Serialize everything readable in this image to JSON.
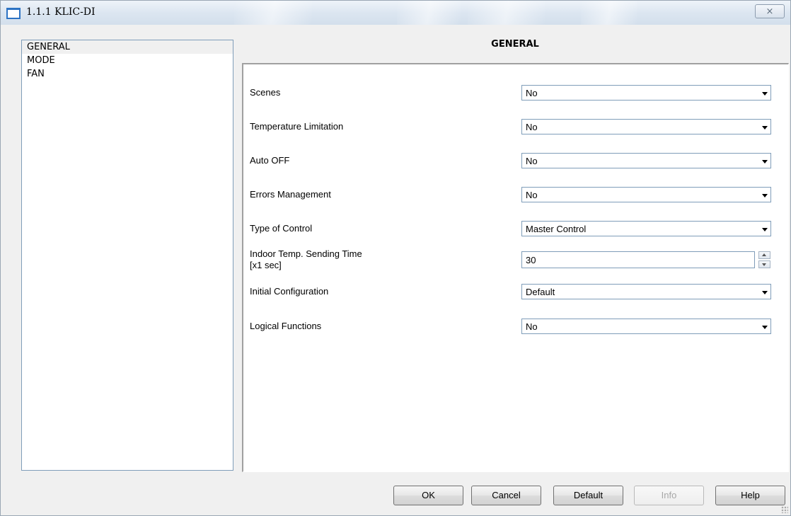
{
  "window": {
    "title": "1.1.1 KLIC-DI",
    "close_glyph": "⨯"
  },
  "nav": {
    "items": [
      {
        "label": "GENERAL",
        "selected": true
      },
      {
        "label": "MODE",
        "selected": false
      },
      {
        "label": "FAN",
        "selected": false
      }
    ]
  },
  "panel": {
    "title": "GENERAL",
    "rows": [
      {
        "label": "Scenes",
        "value": "No",
        "control": "dropdown"
      },
      {
        "label": "Temperature Limitation",
        "value": "No",
        "control": "dropdown"
      },
      {
        "label": "Auto OFF",
        "value": "No",
        "control": "dropdown"
      },
      {
        "label": "Errors Management",
        "value": "No",
        "control": "dropdown"
      },
      {
        "label": "Type of Control",
        "value": "Master Control",
        "control": "dropdown"
      },
      {
        "label": "Indoor Temp. Sending Time",
        "label_line2": "[x1 sec]",
        "value": "30",
        "control": "spinner"
      },
      {
        "label": "Initial Configuration",
        "value": "Default",
        "control": "dropdown"
      },
      {
        "label": "Logical Functions",
        "value": "No",
        "control": "dropdown"
      }
    ]
  },
  "buttons": {
    "ok": "OK",
    "cancel": "Cancel",
    "default": "Default",
    "info": "Info",
    "help": "Help"
  },
  "colors": {
    "title_bar": "#dce6f1",
    "field_border": "#7f9db9",
    "icon_blue": "#2d73c4"
  }
}
